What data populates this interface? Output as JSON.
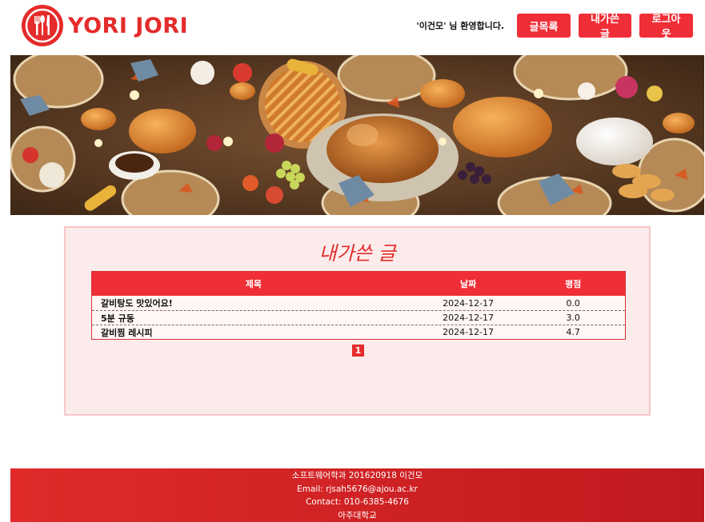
{
  "brand": {
    "name": "YORI JORI",
    "accent_color": "#e52b2b"
  },
  "header": {
    "welcome": "'이건모' 님 환영합니다.",
    "buttons": {
      "list": "글목록",
      "my_posts": "내가쓴 글",
      "logout": "로그아웃"
    }
  },
  "banner": {
    "icon": "thanksgiving-feast-image"
  },
  "main": {
    "title": "내가쓴 글",
    "table": {
      "headers": [
        "제목",
        "날짜",
        "평점"
      ],
      "rows": [
        {
          "title": "갈비탕도 맛있어요!",
          "date": "2024-12-17",
          "rating": "0.0"
        },
        {
          "title": "5분 규동",
          "date": "2024-12-17",
          "rating": "3.0"
        },
        {
          "title": "갈비찜 레시피",
          "date": "2024-12-17",
          "rating": "4.7"
        }
      ]
    },
    "pagination": {
      "current": "1"
    }
  },
  "footer": {
    "line1": "소프트웨어학과 201620918 이건모",
    "line2": "Email: rjsah5676@ajou.ac.kr",
    "line3": "Contact: 010-6385-4676",
    "line4": "아주대학교"
  }
}
